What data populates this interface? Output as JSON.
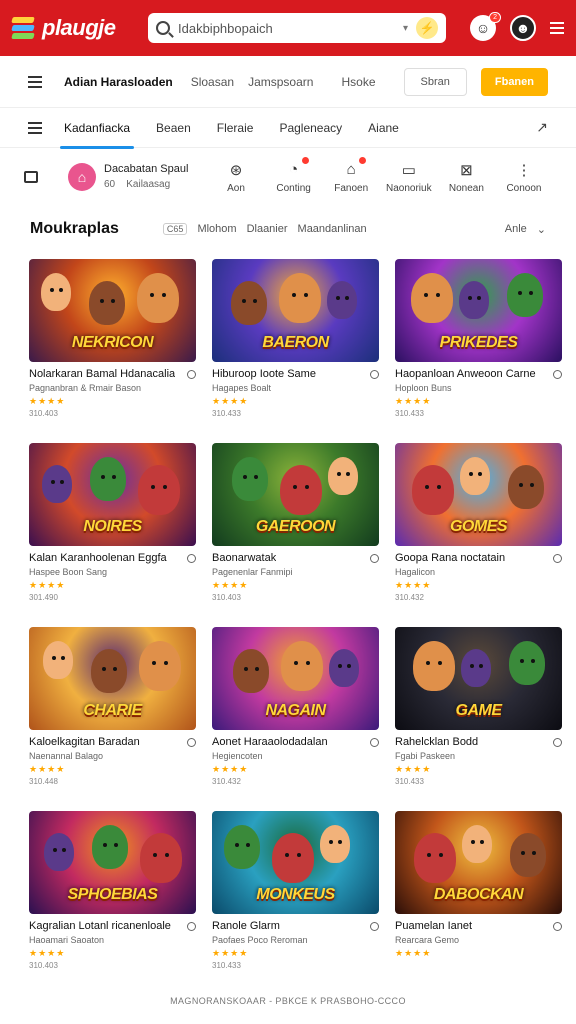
{
  "header": {
    "logo_text": "plaugje",
    "search_value": "Idakbiphbopaich",
    "notif_count": "2"
  },
  "subbar": {
    "brand": "Adian Harasloaden",
    "links": [
      "Sloasan",
      "Jamspsoarn"
    ],
    "right_link": "Hsoke",
    "outline_button": "Sbran",
    "primary_button": "Fbanen"
  },
  "tabs": [
    "Kadanfiacka",
    "Beaen",
    "Fleraie",
    "Pagleneacy",
    "Aiane"
  ],
  "profile": {
    "name": "Dacabatan Spaul",
    "sub_left": "60",
    "sub_right": "Kailaasag"
  },
  "nav": [
    {
      "icon": "explore-icon",
      "label": "Aon",
      "badge": false
    },
    {
      "icon": "gaming-icon",
      "label": "Conting",
      "badge": true
    },
    {
      "icon": "controller-icon",
      "label": "Fanoen",
      "badge": true
    },
    {
      "icon": "monitor-icon",
      "label": "Naonoriuk",
      "badge": false
    },
    {
      "icon": "puzzle-icon",
      "label": "Nonean",
      "badge": false
    },
    {
      "icon": "more-icon",
      "label": "Conoon",
      "badge": false
    }
  ],
  "section": {
    "title": "Moukraplas",
    "tag": "C65",
    "filters": [
      "Mlohom",
      "Dlaanier",
      "Maandanlinan"
    ],
    "sort": "Anle"
  },
  "games": [
    {
      "art_text": "NEKRICON",
      "title": "Nolarkaran Bamal Hdanacalia",
      "sub": "Pagnanbran & Rmair Bason",
      "rating": "★★★★",
      "count": "310.403",
      "colors": [
        "#3a1a4a",
        "#c2461a",
        "#ffb02e"
      ]
    },
    {
      "art_text": "BAERON",
      "title": "Hiburoop Ioote Same",
      "sub": "Hagapes Boalt",
      "rating": "★★★★",
      "count": "310.433",
      "colors": [
        "#1b2f7a",
        "#5a3bc0",
        "#f2a93b"
      ]
    },
    {
      "art_text": "PRIKEDES",
      "title": "Haopanloan Anweoon Carne",
      "sub": "Hoploon Buns",
      "rating": "★★★★",
      "count": "310.433",
      "colors": [
        "#2a1060",
        "#a234c8",
        "#2fa04a"
      ]
    },
    {
      "art_text": "NOIRES",
      "title": "Kalan Karanhoolenan Eggfa",
      "sub": "Haspee Boon Sang",
      "rating": "★★★★",
      "count": "301.490",
      "colors": [
        "#3a0f4f",
        "#d24a2a",
        "#6b2fa0"
      ]
    },
    {
      "art_text": "GAEROON",
      "title": "Baonarwatak",
      "sub": "Pagenenlar Fanmipi",
      "rating": "★★★★",
      "count": "310.403",
      "colors": [
        "#123b1e",
        "#3c7a2a",
        "#8cb33a"
      ]
    },
    {
      "art_text": "GOMES",
      "title": "Goopa Rana noctatain",
      "sub": "Hagalicon",
      "rating": "★★★★",
      "count": "310.432",
      "colors": [
        "#5a2bb0",
        "#f07030",
        "#4ab0e8"
      ]
    },
    {
      "art_text": "CHARIE",
      "title": "Kaloelkagitan Baradan",
      "sub": "Naenannal Balago",
      "rating": "★★★★",
      "count": "310.448",
      "colors": [
        "#b0531a",
        "#f0b040",
        "#5a2a70"
      ]
    },
    {
      "art_text": "NAGAIN",
      "title": "Aonet Haraaolodadalan",
      "sub": "Hegiencoten",
      "rating": "★★★★",
      "count": "310.432",
      "colors": [
        "#3b1a7a",
        "#c23aa0",
        "#f0a030"
      ]
    },
    {
      "art_text": "GAME",
      "title": "Rahelcklan Bodd",
      "sub": "Fgabi Paskeen",
      "rating": "★★★★",
      "count": "310.433",
      "colors": [
        "#0c0c12",
        "#2a2a36",
        "#5b4a3a"
      ]
    },
    {
      "art_text": "SPHOEBIAS",
      "title": "Kagralian Lotanl ricanenloale",
      "sub": "Haoamari Saoaton",
      "rating": "★★★★",
      "count": "310.403",
      "colors": [
        "#2a1050",
        "#c22a60",
        "#f09020"
      ]
    },
    {
      "art_text": "MONKEUS",
      "title": "Ranole Glarm",
      "sub": "Paofaes Poco Reroman",
      "rating": "★★★★",
      "count": "310.433",
      "colors": [
        "#0a4a6a",
        "#2aa0c0",
        "#1a6a3a"
      ]
    },
    {
      "art_text": "DABOCKAN",
      "title": "Puamelan Ianet",
      "sub": "Rearcara Gemo",
      "rating": "★★★★",
      "count": "",
      "colors": [
        "#2a0e08",
        "#c2561a",
        "#f0c040"
      ]
    }
  ],
  "footer": "MAGNORANSKOAAR - PBKCE K PRASBOHO-CCCO"
}
